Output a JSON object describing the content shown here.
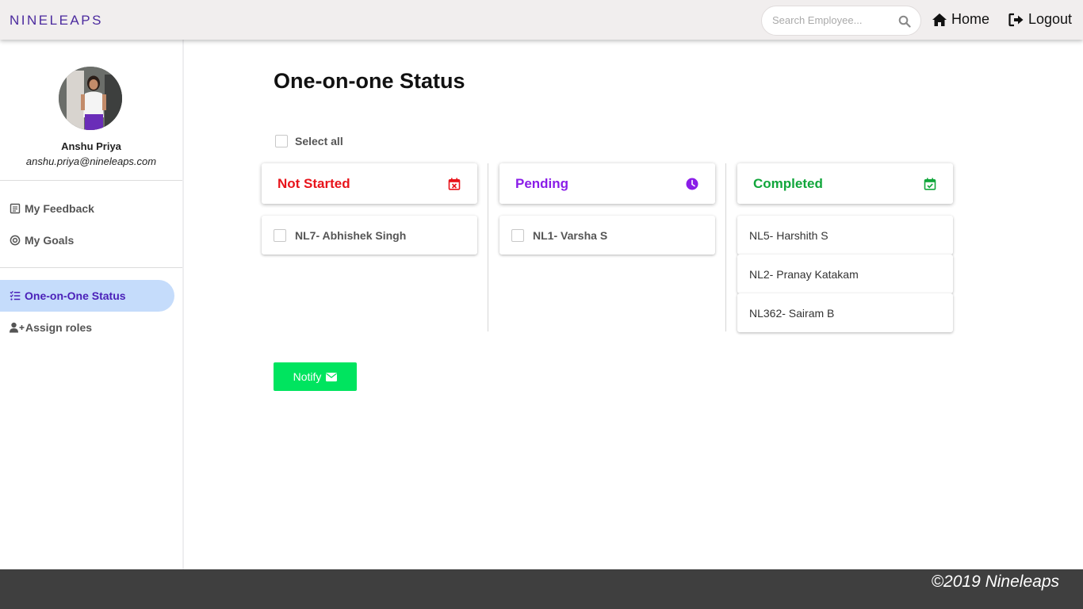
{
  "header": {
    "logo_text": "NINELEAPS",
    "search_placeholder": "Search Employee...",
    "home_label": "Home",
    "logout_label": "Logout"
  },
  "sidebar": {
    "user_name": "Anshu Priya",
    "user_email": "anshu.priya@nineleaps.com",
    "items": [
      {
        "label": "My Feedback",
        "icon": "feedback-icon"
      },
      {
        "label": "My Goals",
        "icon": "target-icon"
      },
      {
        "label": "One-on-One Status",
        "icon": "list-check-icon",
        "active": true
      },
      {
        "label": "Assign roles",
        "icon": "user-plus-icon"
      }
    ]
  },
  "main": {
    "title": "One-on-one Status",
    "select_all_label": "Select all",
    "columns": [
      {
        "title": "Not Started",
        "color": "#e8141b",
        "icon": "calendar-x-icon",
        "items": [
          {
            "label": "NL7- Abhishek Singh",
            "checkbox": true
          }
        ]
      },
      {
        "title": "Pending",
        "color": "#8a1de8",
        "icon": "clock-icon",
        "items": [
          {
            "label": "NL1- Varsha S",
            "checkbox": true
          }
        ]
      },
      {
        "title": "Completed",
        "color": "#11a63b",
        "icon": "calendar-check-icon",
        "items": [
          {
            "label": "NL5- Harshith S",
            "checkbox": false
          },
          {
            "label": "NL2- Pranay Katakam",
            "checkbox": false
          },
          {
            "label": "NL362- Sairam B",
            "checkbox": false
          }
        ]
      }
    ],
    "notify_label": "Notify"
  },
  "footer": {
    "copyright": "©2019 Nineleaps"
  },
  "colors": {
    "accent": "#4a1fb8",
    "active_bg": "#c5dcfb",
    "notify_bg": "#00e45f",
    "footer_bg": "#3f3f3f"
  }
}
